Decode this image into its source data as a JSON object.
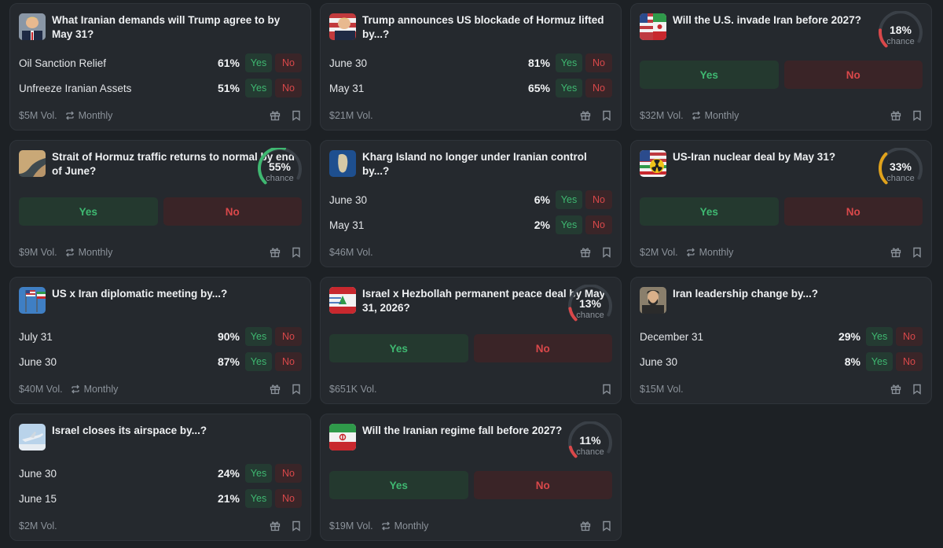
{
  "colors": {
    "page_bg": "#1d2125",
    "card_bg": "#25292e",
    "yes": "#3fb871",
    "no": "#d9484a",
    "gauge_red": "#d9484a",
    "gauge_green": "#3fb871",
    "gauge_orange": "#e0a21b"
  },
  "labels": {
    "yes": "Yes",
    "no": "No",
    "chance": "chance"
  },
  "cards": [
    {
      "title": "What Iranian demands will Trump agree to by May 31?",
      "image": "trump-portrait",
      "outcomes": [
        {
          "name": "Oil Sanction Relief",
          "percent": "61%"
        },
        {
          "name": "Unfreeze Iranian Assets",
          "percent": "51%"
        }
      ],
      "volume": "$5M Vol.",
      "recurrence": "Monthly"
    },
    {
      "title": "Trump announces US blockade of Hormuz lifted by...?",
      "image": "trump-portrait",
      "outcomes": [
        {
          "name": "June 30",
          "percent": "81%"
        },
        {
          "name": "May 31",
          "percent": "65%"
        }
      ],
      "volume": "$21M Vol."
    },
    {
      "title": "Will the U.S. invade Iran before 2027?",
      "image": "iran-flag",
      "chance": "18%",
      "chance_value": 0.18,
      "volume": "$32M Vol.",
      "recurrence": "Monthly"
    },
    {
      "title": "Strait of Hormuz traffic returns to normal by end of June?",
      "image": "strait-map",
      "chance": "55%",
      "chance_value": 0.55,
      "volume": "$9M Vol.",
      "recurrence": "Monthly"
    },
    {
      "title": "Kharg Island no longer under Iranian control by...?",
      "image": "island-map",
      "outcomes": [
        {
          "name": "June 30",
          "percent": "6%"
        },
        {
          "name": "May 31",
          "percent": "2%"
        }
      ],
      "volume": "$46M Vol."
    },
    {
      "title": "US-Iran nuclear deal by May 31?",
      "image": "nuclear-flag",
      "chance": "33%",
      "chance_value": 0.33,
      "volume": "$2M Vol.",
      "recurrence": "Monthly"
    },
    {
      "title": "US x Iran diplomatic meeting by...?",
      "image": "flags",
      "outcomes": [
        {
          "name": "July 31",
          "percent": "90%"
        },
        {
          "name": "June 30",
          "percent": "87%"
        }
      ],
      "volume": "$40M Vol.",
      "recurrence": "Monthly"
    },
    {
      "title": "Israel x Hezbollah permanent peace deal by May 31, 2026?",
      "image": "israel-lebanon-flags",
      "chance": "13%",
      "chance_value": 0.13,
      "volume": "$651K Vol."
    },
    {
      "title": "Iran leadership change by...?",
      "image": "leader-portrait",
      "outcomes": [
        {
          "name": "December 31",
          "percent": "29%"
        },
        {
          "name": "June 30",
          "percent": "8%"
        }
      ],
      "volume": "$15M Vol."
    },
    {
      "title": "Israel closes its airspace by...?",
      "image": "israel-jet",
      "outcomes": [
        {
          "name": "June 30",
          "percent": "24%"
        },
        {
          "name": "June 15",
          "percent": "21%"
        }
      ],
      "volume": "$2M Vol."
    },
    {
      "title": "Will the Iranian regime fall before 2027?",
      "image": "iran-flag",
      "chance": "11%",
      "chance_value": 0.11,
      "volume": "$19M Vol.",
      "recurrence": "Monthly"
    }
  ]
}
